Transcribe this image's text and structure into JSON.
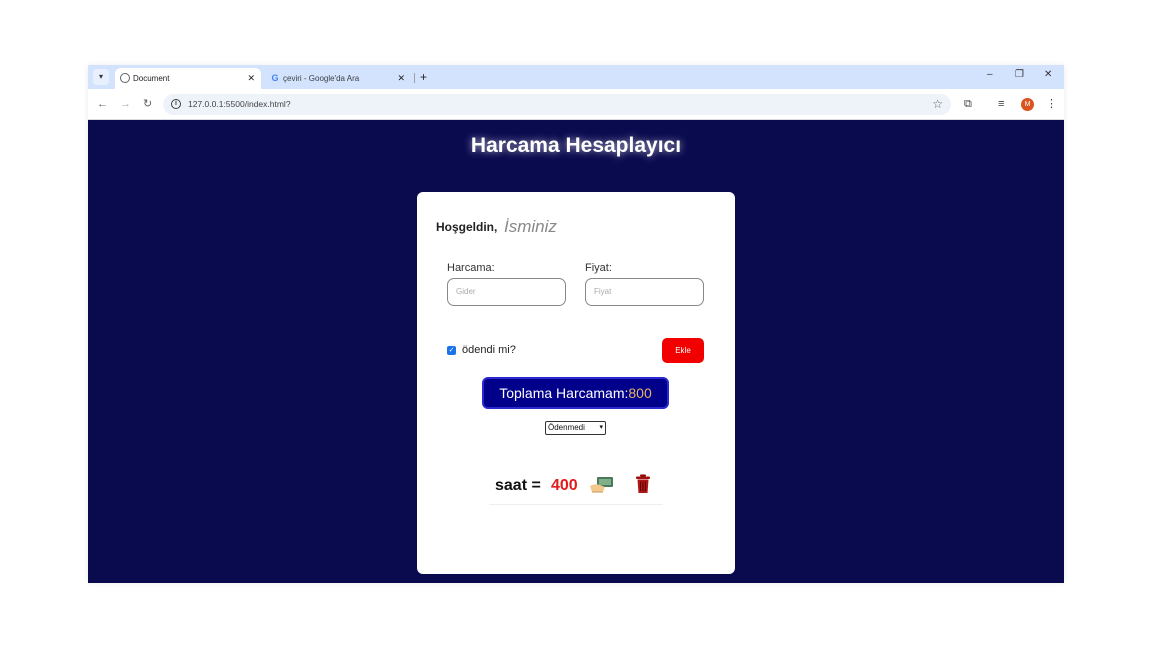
{
  "browser": {
    "tabs": [
      {
        "title": "Document",
        "close": "✕"
      },
      {
        "title": "çeviri - Google'da Ara",
        "close": "✕"
      }
    ],
    "new_tab": "+",
    "window": {
      "minimize": "–",
      "restore": "❐",
      "close": "✕"
    },
    "url": "127.0.0.1:5500/index.html?",
    "profile_initial": "M"
  },
  "page": {
    "title": "Harcama Hesaplayıcı",
    "greeting": "Hoşgeldin,",
    "name_placeholder": "İsminiz",
    "expense_label": "Harcama:",
    "expense_placeholder": "Gider",
    "price_label": "Fiyat:",
    "price_placeholder": "Fiyat",
    "paid_label": "ödendi mi?",
    "paid_checked": true,
    "add_button": "Ekle",
    "total_label": "Toplama Harcamam:",
    "total_value": "800",
    "filter_selected": "Ödenmedi",
    "items": [
      {
        "name": "saat",
        "eq": "=",
        "price": "400"
      }
    ]
  },
  "colors": {
    "page_background": "#0a0a4f",
    "add_button": "#f20000",
    "total_box": "#00008b",
    "total_amount": "#e6b566",
    "item_price": "#e31b1b"
  }
}
